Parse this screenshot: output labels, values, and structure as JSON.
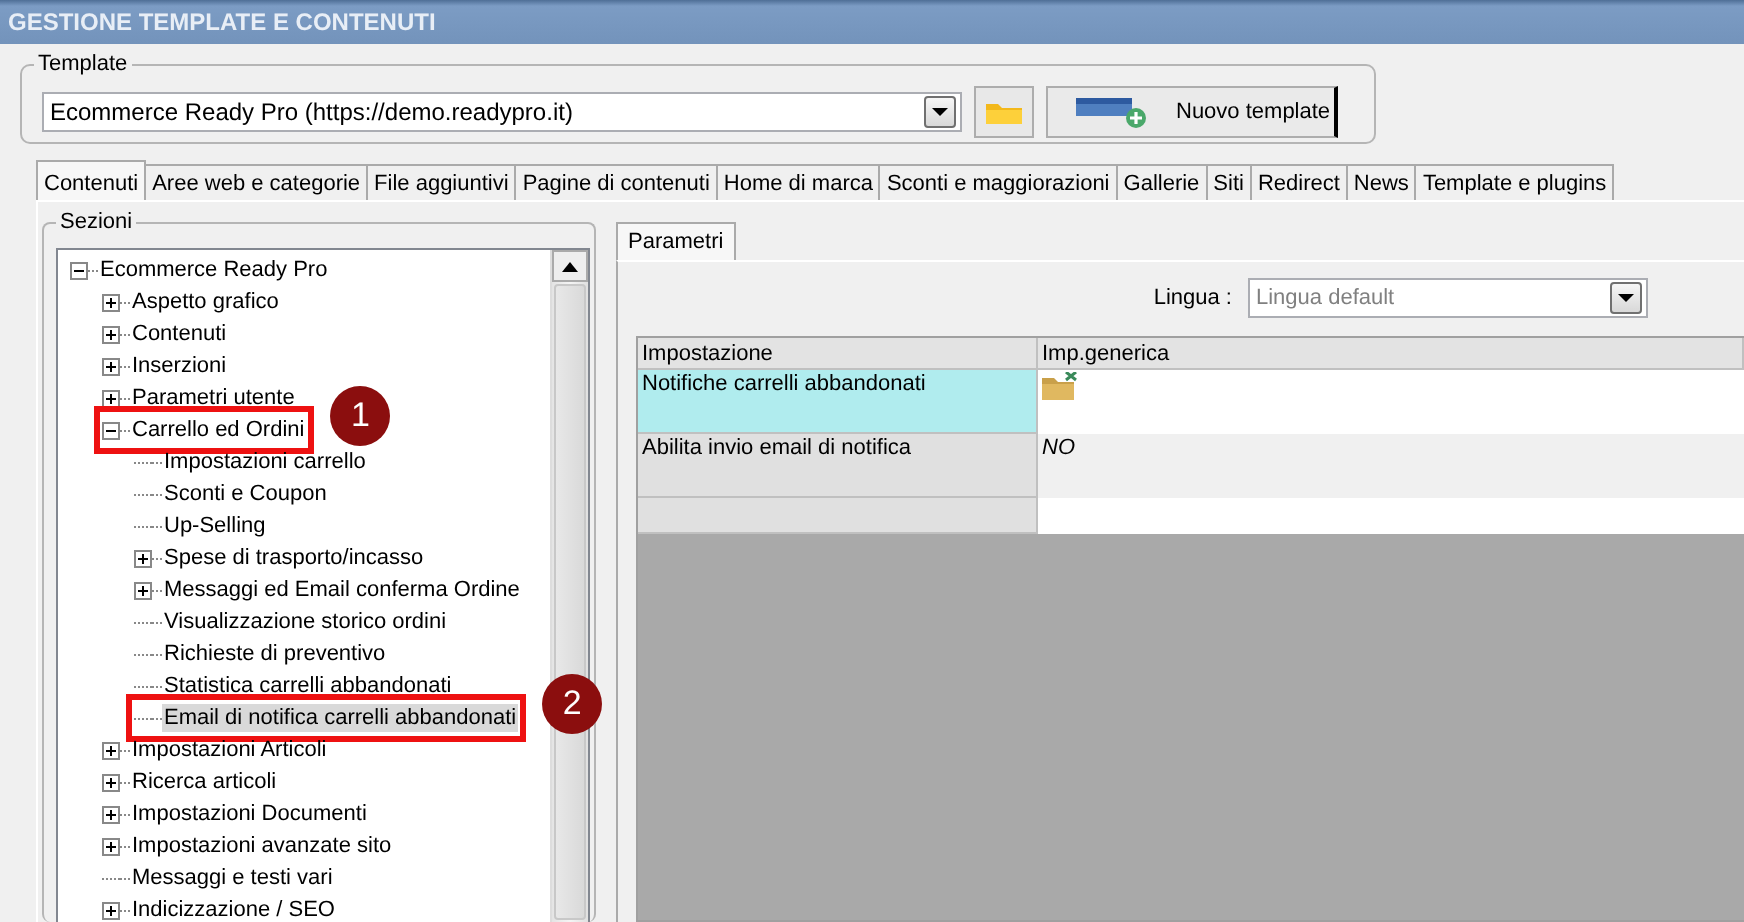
{
  "window": {
    "title": "GESTIONE TEMPLATE E CONTENUTI"
  },
  "template": {
    "legend": "Template",
    "value": "Ecommerce Ready Pro (https://demo.readypro.it)",
    "new_button": "Nuovo template"
  },
  "tabs": [
    {
      "label": "Contenuti",
      "selected": true
    },
    {
      "label": "Aree web e categorie",
      "selected": false
    },
    {
      "label": "File aggiuntivi",
      "selected": false
    },
    {
      "label": "Pagine di contenuti",
      "selected": false
    },
    {
      "label": "Home di marca",
      "selected": false
    },
    {
      "label": "Sconti e maggiorazioni",
      "selected": false
    },
    {
      "label": "Gallerie",
      "selected": false
    },
    {
      "label": "Siti",
      "selected": false
    },
    {
      "label": "Redirect",
      "selected": false
    },
    {
      "label": "News",
      "selected": false
    },
    {
      "label": "Template e plugins",
      "selected": false
    }
  ],
  "sections": {
    "legend": "Sezioni",
    "tree": [
      {
        "label": "Ecommerce Ready Pro",
        "kind": "expanded",
        "selected": false,
        "children": [
          {
            "label": "Aspetto grafico",
            "kind": "collapsed",
            "selected": false
          },
          {
            "label": "Contenuti",
            "kind": "collapsed",
            "selected": false
          },
          {
            "label": "Inserzioni",
            "kind": "collapsed",
            "selected": false
          },
          {
            "label": "Parametri utente",
            "kind": "collapsed",
            "selected": false
          },
          {
            "label": "Carrello ed Ordini",
            "kind": "expanded",
            "selected": false,
            "callout": "1",
            "children": [
              {
                "label": "Impostazioni carrello",
                "kind": "leaf",
                "selected": false
              },
              {
                "label": "Sconti e Coupon",
                "kind": "leaf",
                "selected": false
              },
              {
                "label": "Up-Selling",
                "kind": "leaf",
                "selected": false
              },
              {
                "label": "Spese di trasporto/incasso",
                "kind": "collapsed",
                "selected": false
              },
              {
                "label": "Messaggi ed Email conferma Ordine",
                "kind": "collapsed",
                "selected": false
              },
              {
                "label": "Visualizzazione storico ordini",
                "kind": "leaf",
                "selected": false
              },
              {
                "label": "Richieste di preventivo",
                "kind": "leaf",
                "selected": false
              },
              {
                "label": "Statistica carrelli abbandonati",
                "kind": "leaf",
                "selected": false
              },
              {
                "label": "Email di notifica carrelli abbandonati",
                "kind": "leaf",
                "selected": true,
                "callout": "2"
              }
            ]
          },
          {
            "label": "Impostazioni Articoli",
            "kind": "collapsed",
            "selected": false
          },
          {
            "label": "Ricerca articoli",
            "kind": "collapsed",
            "selected": false
          },
          {
            "label": "Impostazioni Documenti",
            "kind": "collapsed",
            "selected": false
          },
          {
            "label": "Impostazioni avanzate sito",
            "kind": "collapsed",
            "selected": false
          },
          {
            "label": "Messaggi e testi vari",
            "kind": "leaf",
            "selected": false
          },
          {
            "label": "Indicizzazione / SEO",
            "kind": "collapsed",
            "selected": false
          }
        ]
      }
    ]
  },
  "params": {
    "tab": "Parametri",
    "language_label": "Lingua :",
    "language_value": "Lingua default",
    "columns": [
      "Impostazione",
      "Imp.generica"
    ],
    "rows": [
      {
        "setting": "Notifiche carrelli abbandonati",
        "kind": "icon",
        "selected": true
      },
      {
        "setting": "Abilita invio email di notifica",
        "kind": "text",
        "value": "NO",
        "selected": false
      }
    ]
  }
}
